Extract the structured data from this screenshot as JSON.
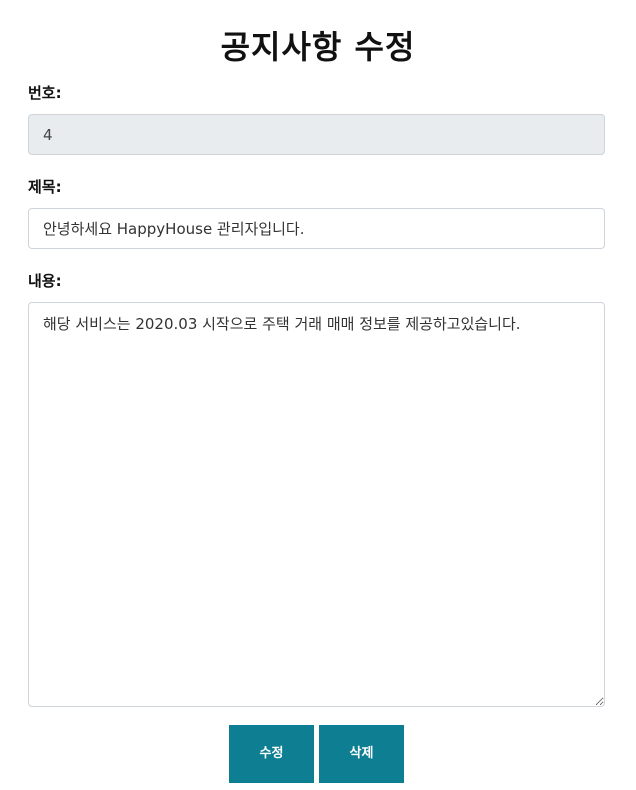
{
  "page": {
    "title": "공지사항 수정"
  },
  "form": {
    "number_label": "번호:",
    "number_value": "4",
    "subject_label": "제목:",
    "subject_value": "안녕하세요 HappyHouse 관리자입니다.",
    "content_label": "내용:",
    "content_value": "해당 서비스는 2020.03 시작으로 주택 거래 매매 정보를 제공하고있습니다."
  },
  "buttons": {
    "edit_label": "수정",
    "delete_label": "삭제"
  }
}
